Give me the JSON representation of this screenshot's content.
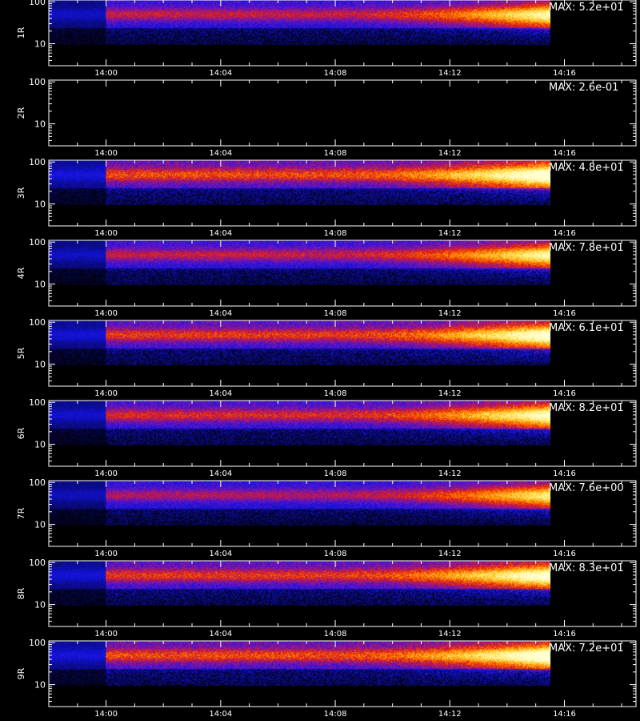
{
  "chart_data": {
    "type": "heatmap",
    "xlabel": "",
    "x_tick_labels": [
      "14:00",
      "14:04",
      "14:08",
      "14:12",
      "14:16"
    ],
    "x_tick_minutes": [
      0,
      4,
      8,
      12,
      16
    ],
    "x_range_minutes": [
      -2.0,
      18.5
    ],
    "data_range_minutes": [
      -2.0,
      15.5
    ],
    "instrument_on_minute": 0.0,
    "y_scale": "log",
    "y_range": [
      3,
      110
    ],
    "y_tick_labels": [
      "100",
      "10"
    ],
    "y_tick_values": [
      100,
      10
    ],
    "colormap": [
      "#000000",
      "#0a0a80",
      "#1414e6",
      "#7814b4",
      "#e61e0a",
      "#ff8c00",
      "#ffe650",
      "#ffffd2"
    ],
    "panels": [
      {
        "name": "1R",
        "max_label": "MAX: 5.2e+01",
        "intensity": 0.85
      },
      {
        "name": "2R",
        "max_label": "MAX: 2.6e-01",
        "intensity": 0.0
      },
      {
        "name": "3R",
        "max_label": "MAX: 4.8e+01",
        "intensity": 1.0
      },
      {
        "name": "4R",
        "max_label": "MAX: 7.8e+01",
        "intensity": 0.85
      },
      {
        "name": "5R",
        "max_label": "MAX: 6.1e+01",
        "intensity": 0.95
      },
      {
        "name": "6R",
        "max_label": "MAX: 8.2e+01",
        "intensity": 0.9
      },
      {
        "name": "7R",
        "max_label": "MAX: 7.6e+00",
        "intensity": 0.8
      },
      {
        "name": "8R",
        "max_label": "MAX: 8.3e+01",
        "intensity": 0.95
      },
      {
        "name": "9R",
        "max_label": "MAX: 7.2e+01",
        "intensity": 1.0
      }
    ]
  }
}
